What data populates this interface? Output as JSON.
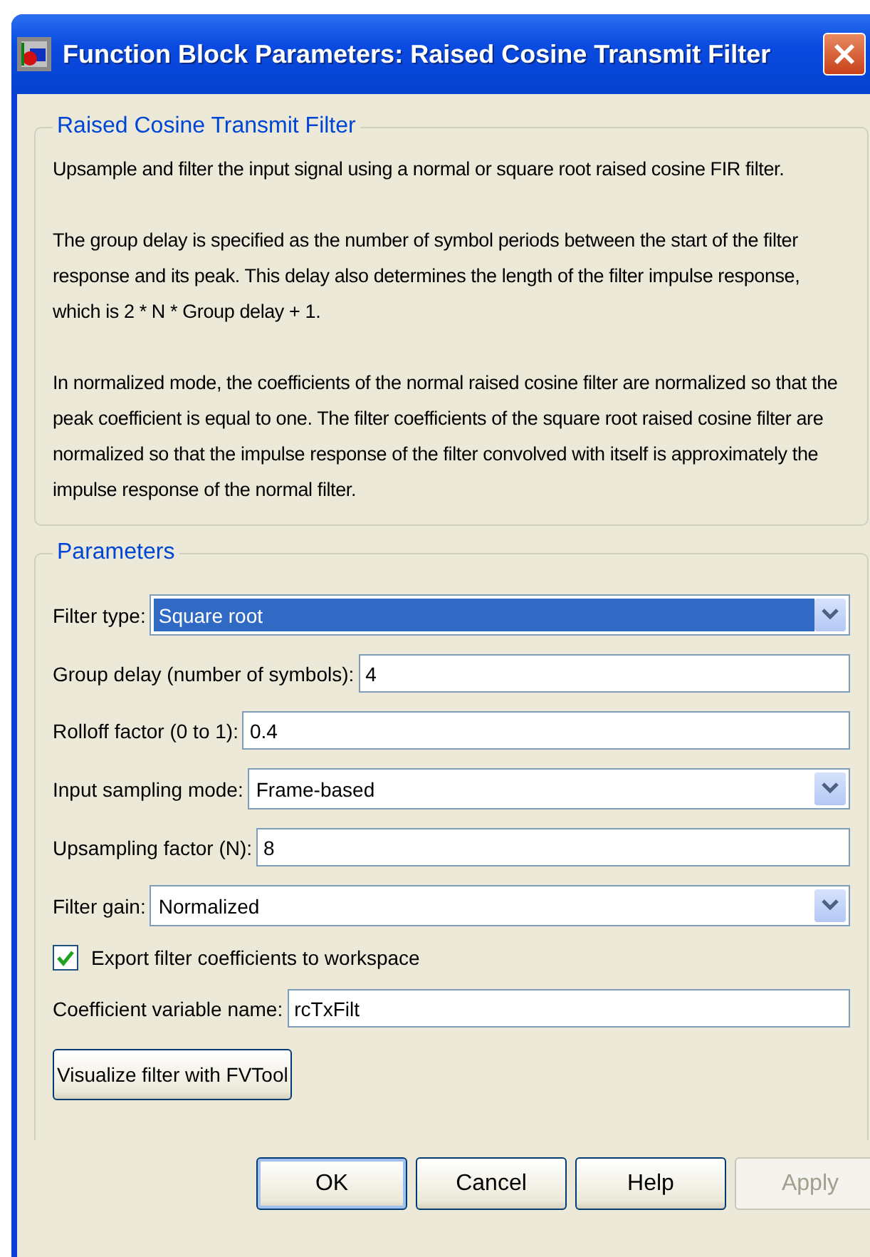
{
  "window": {
    "title": "Function Block Parameters: Raised Cosine Transmit Filter"
  },
  "description": {
    "title": "Raised Cosine Transmit Filter",
    "paragraphs": [
      "Upsample and filter the input signal using a normal or square root raised cosine FIR filter.",
      "The group delay is specified as the number of symbol periods between the start of the filter response and its peak. This delay also determines the length of the filter impulse response, which is 2 * N * Group delay + 1.",
      "In normalized mode, the coefficients of the normal raised cosine filter are normalized so that the peak coefficient is equal to one. The filter coefficients of the square root raised cosine filter are normalized so that the impulse response of the filter convolved with itself is approximately the impulse response of the normal filter."
    ]
  },
  "parameters": {
    "title": "Parameters",
    "items": [
      {
        "kind": "dropdown",
        "label": "Filter type:",
        "value": "Square root",
        "selected": true
      },
      {
        "kind": "text",
        "label": "Group delay (number of symbols):",
        "value": "4"
      },
      {
        "kind": "text",
        "label": "Rolloff factor (0 to 1):",
        "value": "0.4"
      },
      {
        "kind": "dropdown",
        "label": "Input sampling mode:",
        "value": "Frame-based",
        "selected": false
      },
      {
        "kind": "text",
        "label": "Upsampling factor (N):",
        "value": "8"
      },
      {
        "kind": "dropdown",
        "label": "Filter gain:",
        "value": "Normalized",
        "selected": false
      },
      {
        "kind": "checkbox",
        "label": "Export filter coefficients to workspace",
        "checked": true
      },
      {
        "kind": "text",
        "label": "Coefficient variable name:",
        "value": "rcTxFilt"
      },
      {
        "kind": "button",
        "label": "Visualize filter with FVTool"
      }
    ]
  },
  "buttons": [
    {
      "label": "OK",
      "focused": true,
      "disabled": false
    },
    {
      "label": "Cancel",
      "focused": false,
      "disabled": false
    },
    {
      "label": "Help",
      "focused": false,
      "disabled": false
    },
    {
      "label": "Apply",
      "focused": false,
      "disabled": true
    }
  ]
}
